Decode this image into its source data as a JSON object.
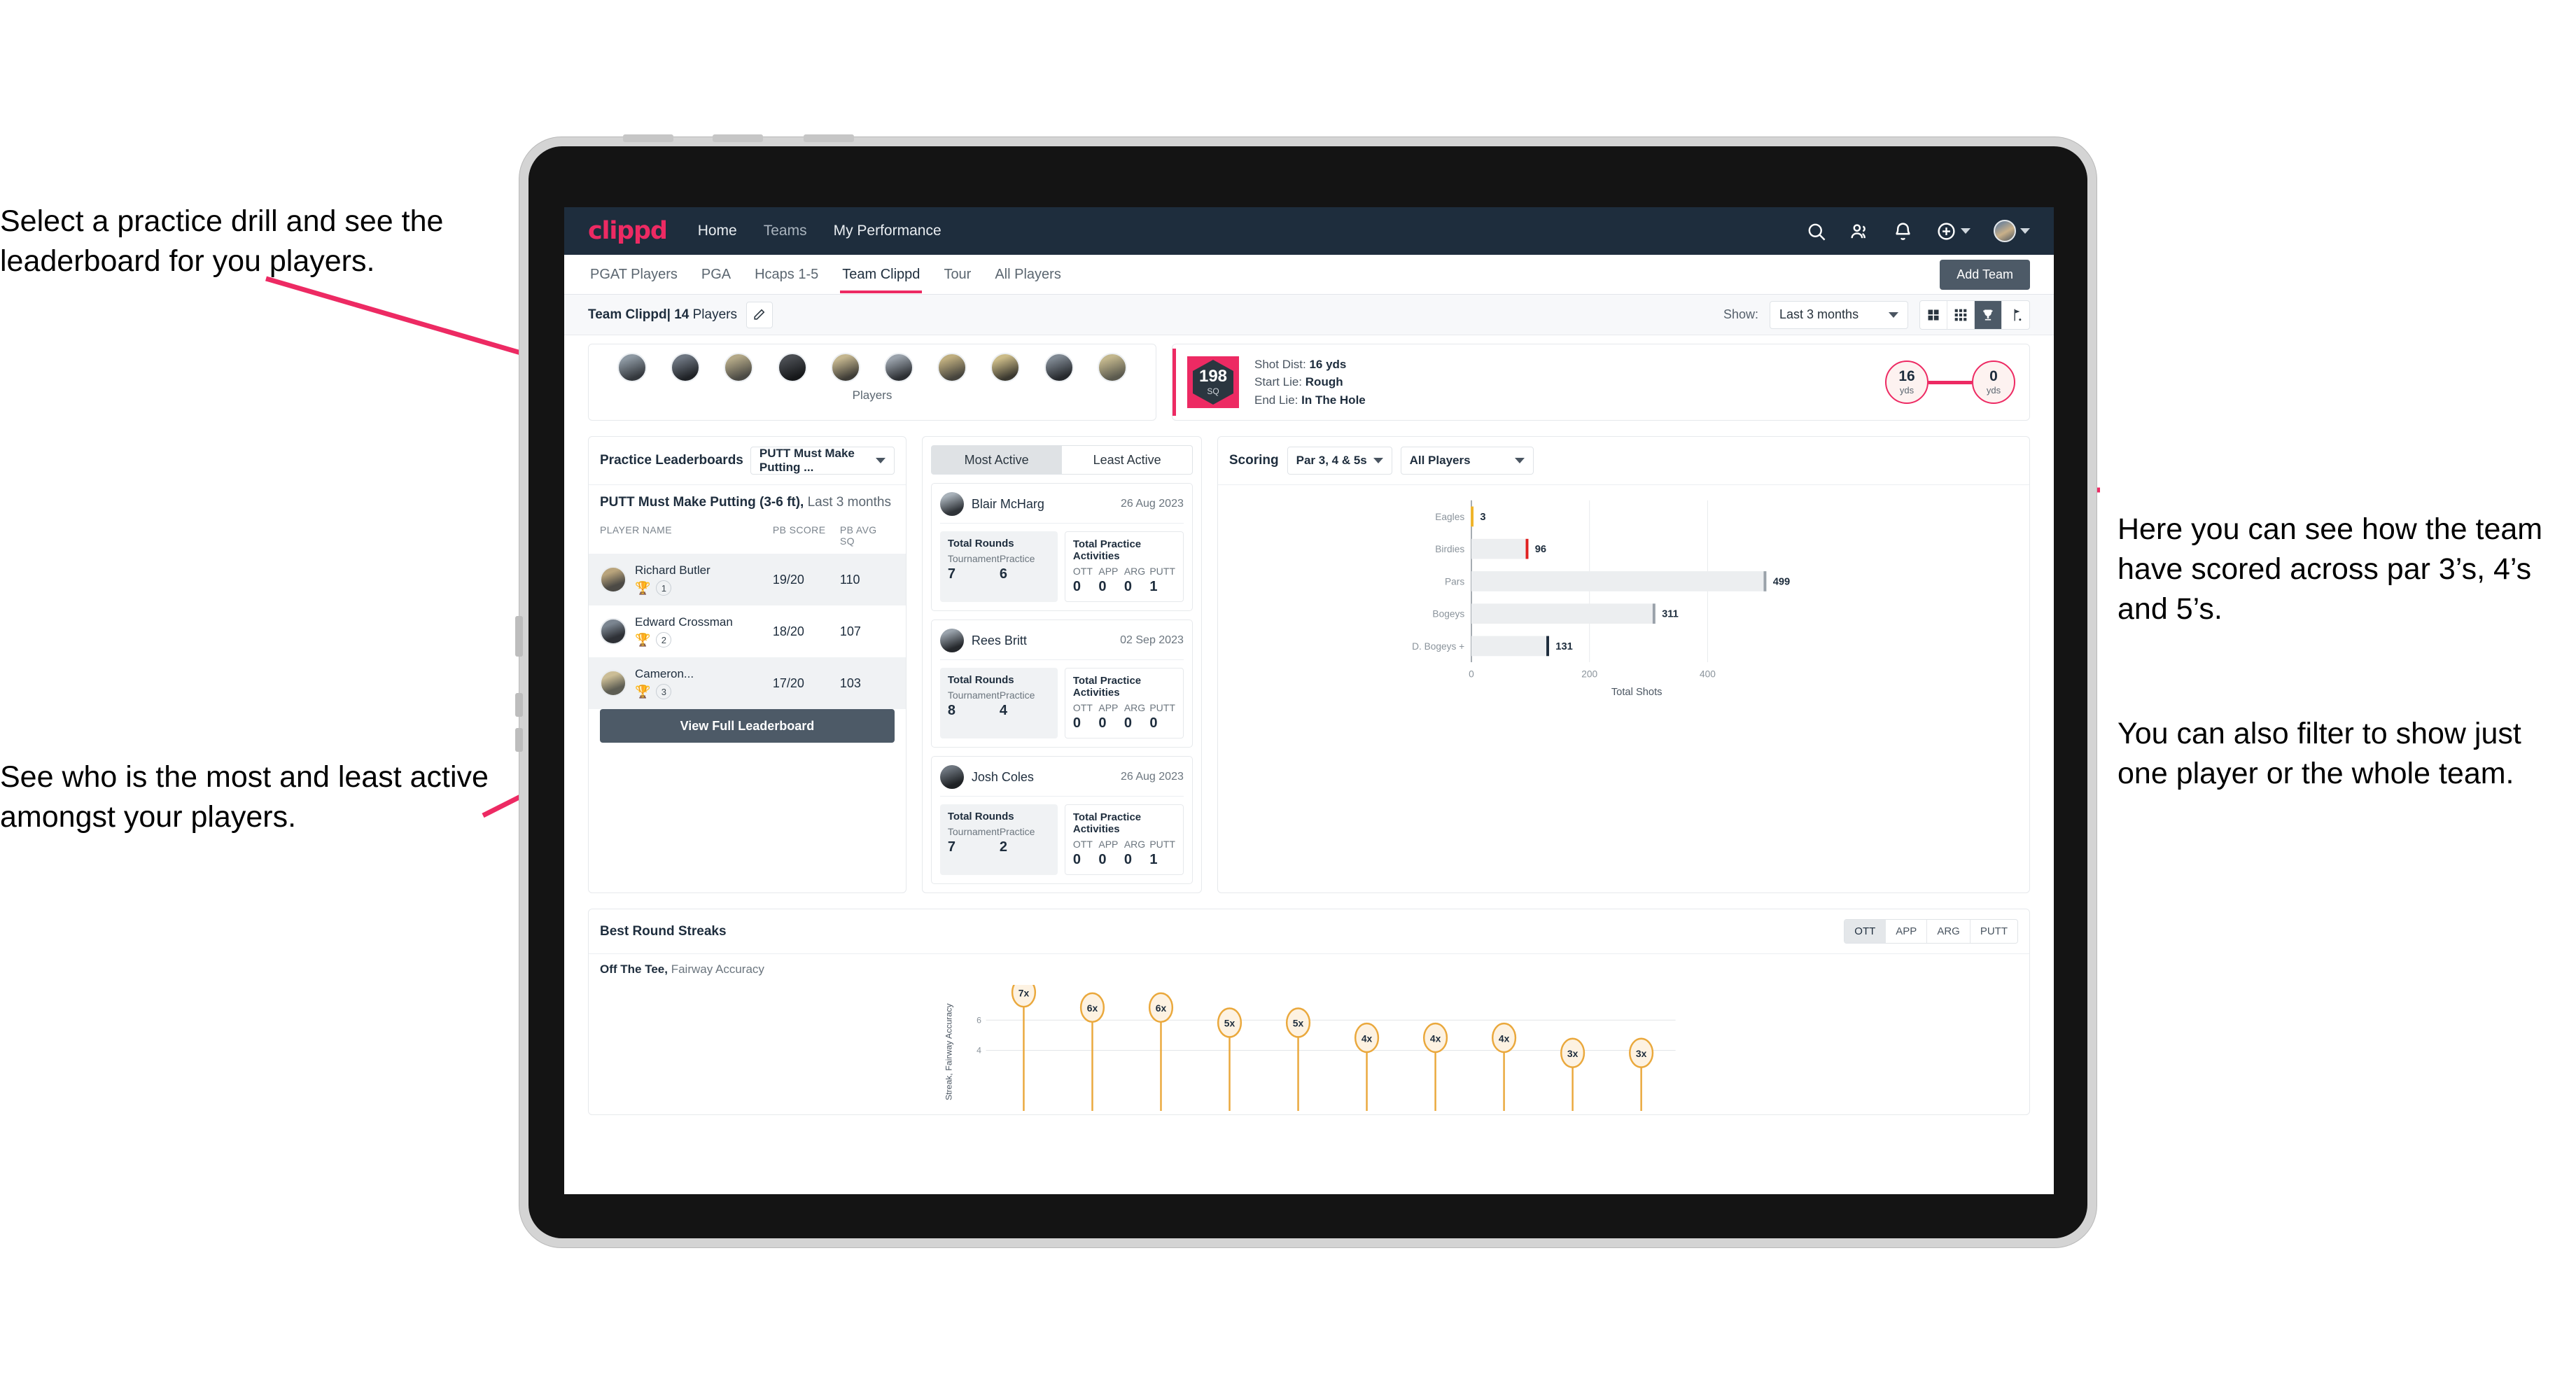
{
  "annotations": {
    "top_left": "Select a practice drill and see the leaderboard for you players.",
    "bottom_left": "See who is the most and least active amongst your players.",
    "right_1": "Here you can see how the team have scored across par 3’s, 4’s and 5’s.",
    "right_2": "You can also filter to show just one player or the whole team.",
    "arrow_color": "#ed2a63"
  },
  "app": {
    "logo": "clippd",
    "brand_color": "#ed2a63",
    "header_bg": "#1e2d3d",
    "nav": [
      {
        "label": "Home",
        "active": true
      },
      {
        "label": "Teams",
        "active": false
      },
      {
        "label": "My Performance",
        "active": false
      }
    ],
    "header_icons": [
      {
        "name": "search-icon"
      },
      {
        "name": "people-icon"
      },
      {
        "name": "bell-icon"
      },
      {
        "name": "plus-circle-icon"
      },
      {
        "name": "avatar"
      }
    ]
  },
  "tabs": [
    {
      "label": "PGAT Players",
      "active": false
    },
    {
      "label": "PGA",
      "active": false
    },
    {
      "label": "Hcaps 1-5",
      "active": false
    },
    {
      "label": "Team Clippd",
      "active": true
    },
    {
      "label": "Tour",
      "active": false
    },
    {
      "label": "All Players",
      "active": false
    }
  ],
  "add_team_button": "Add Team",
  "subbar": {
    "team_name": "Team Clippd",
    "team_count": "| 14",
    "team_suffix": "Players",
    "edit_icon": "pencil-icon",
    "show_label": "Show:",
    "show_value": "Last 3 months",
    "view_toggle": [
      {
        "name": "grid-large-icon",
        "active": false
      },
      {
        "name": "grid-small-icon",
        "active": false
      },
      {
        "name": "trophy-icon",
        "active": true
      },
      {
        "name": "golf-flag-icon",
        "active": false
      }
    ]
  },
  "players_strip": {
    "caption": "Players",
    "count": 10
  },
  "shot_card": {
    "sq_value": "198",
    "sq_label": "SQ",
    "lines": [
      {
        "label": "Shot Dist:",
        "value": "16 yds"
      },
      {
        "label": "Start Lie:",
        "value": "Rough"
      },
      {
        "label": "End Lie:",
        "value": "In The Hole"
      }
    ],
    "start_dist": "16",
    "start_unit": "yds",
    "end_dist": "0",
    "end_unit": "yds"
  },
  "leaderboard": {
    "title": "Practice Leaderboards",
    "drill_select": "PUTT Must Make Putting ...",
    "subtitle_bold": "PUTT Must Make Putting (3-6 ft),",
    "subtitle_rest": " Last 3 months",
    "columns": [
      "PLAYER NAME",
      "PB SCORE",
      "PB AVG SQ"
    ],
    "rows": [
      {
        "name": "Richard Butler",
        "rank": "1",
        "trophy": "gold",
        "score": "19/20",
        "avg": "110",
        "shaded": true
      },
      {
        "name": "Edward Crossman",
        "rank": "2",
        "trophy": "silver",
        "score": "18/20",
        "avg": "107",
        "shaded": false
      },
      {
        "name": "Cameron...",
        "rank": "3",
        "trophy": "bronze",
        "score": "17/20",
        "avg": "103",
        "shaded": true
      }
    ],
    "button": "View Full Leaderboard"
  },
  "activity": {
    "tabs": [
      {
        "label": "Most Active",
        "active": true
      },
      {
        "label": "Least Active",
        "active": false
      }
    ],
    "players": [
      {
        "name": "Blair McHarg",
        "date": "26 Aug 2023",
        "rounds_title": "Total Rounds",
        "rounds": [
          {
            "label": "Tournament",
            "value": "7"
          },
          {
            "label": "Practice",
            "value": "6"
          }
        ],
        "practice_title": "Total Practice Activities",
        "practice": [
          {
            "label": "OTT",
            "value": "0"
          },
          {
            "label": "APP",
            "value": "0"
          },
          {
            "label": "ARG",
            "value": "0"
          },
          {
            "label": "PUTT",
            "value": "1"
          }
        ]
      },
      {
        "name": "Rees Britt",
        "date": "02 Sep 2023",
        "rounds_title": "Total Rounds",
        "rounds": [
          {
            "label": "Tournament",
            "value": "8"
          },
          {
            "label": "Practice",
            "value": "4"
          }
        ],
        "practice_title": "Total Practice Activities",
        "practice": [
          {
            "label": "OTT",
            "value": "0"
          },
          {
            "label": "APP",
            "value": "0"
          },
          {
            "label": "ARG",
            "value": "0"
          },
          {
            "label": "PUTT",
            "value": "0"
          }
        ]
      },
      {
        "name": "Josh Coles",
        "date": "26 Aug 2023",
        "rounds_title": "Total Rounds",
        "rounds": [
          {
            "label": "Tournament",
            "value": "7"
          },
          {
            "label": "Practice",
            "value": "2"
          }
        ],
        "practice_title": "Total Practice Activities",
        "practice": [
          {
            "label": "OTT",
            "value": "0"
          },
          {
            "label": "APP",
            "value": "0"
          },
          {
            "label": "ARG",
            "value": "0"
          },
          {
            "label": "PUTT",
            "value": "1"
          }
        ]
      }
    ]
  },
  "scoring": {
    "title": "Scoring",
    "par_filter": "Par 3, 4 & 5s",
    "player_filter": "All Players"
  },
  "streaks": {
    "title": "Best Round Streaks",
    "toggle": [
      {
        "label": "OTT",
        "active": true
      },
      {
        "label": "APP",
        "active": false
      },
      {
        "label": "ARG",
        "active": false
      },
      {
        "label": "PUTT",
        "active": false
      }
    ],
    "subtitle_bold": "Off The Tee,",
    "subtitle_rest": " Fairway Accuracy"
  },
  "chart_data": [
    {
      "type": "bar",
      "orientation": "horizontal",
      "title": "Scoring",
      "categories": [
        "Eagles",
        "Birdies",
        "Pars",
        "Bogeys",
        "D. Bogeys +"
      ],
      "values": [
        3,
        96,
        499,
        311,
        131
      ],
      "bar_colors": [
        "#f0b429",
        "#e02020",
        "#9aa2aa",
        "#9aa2aa",
        "#1e2d3d"
      ],
      "xlabel": "Total Shots",
      "ylabel": "",
      "xticks": [
        0,
        200,
        400
      ],
      "xlim": [
        0,
        560
      ],
      "grid": true,
      "legend": "none"
    },
    {
      "type": "scatter",
      "variant": "lollipop",
      "title": "Best Round Streaks",
      "subtitle": "Off The Tee, Fairway Accuracy",
      "ylabel": "Streak, Fairway Accuracy",
      "xlabel": "",
      "yticks": [
        4,
        6
      ],
      "ylim": [
        0,
        7.8
      ],
      "marker_color": "#eaa83c",
      "marker_fill": "#fdf2e2",
      "labels": [
        "7x",
        "6x",
        "6x",
        "5x",
        "5x",
        "4x",
        "4x",
        "4x",
        "3x",
        "3x"
      ],
      "values": [
        7,
        6,
        6,
        5,
        5,
        4,
        4,
        4,
        3,
        3
      ],
      "grid": true
    }
  ]
}
